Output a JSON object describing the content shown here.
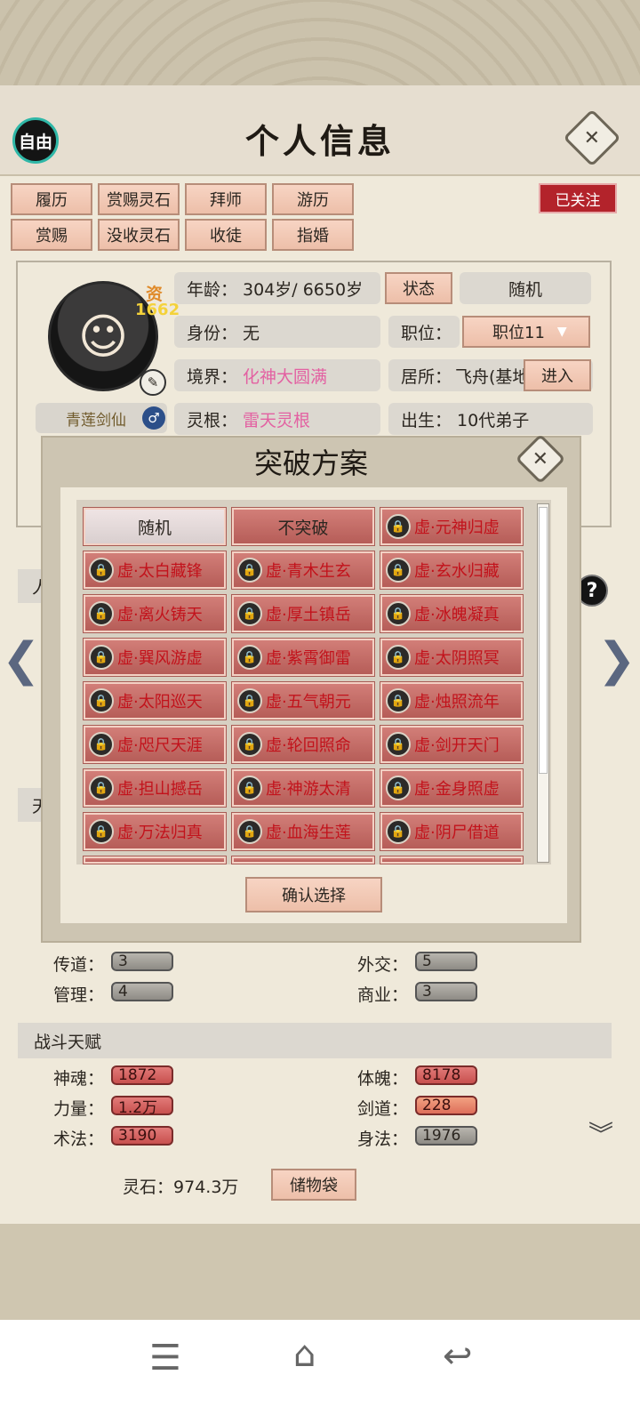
{
  "header": {
    "free_label": "自由",
    "title": "个人信息",
    "follow_label": "已关注"
  },
  "actions": {
    "row1": [
      "履历",
      "赏赐灵石",
      "拜师",
      "游历"
    ],
    "row2": [
      "赏赐",
      "没收灵石",
      "收徒",
      "指婚"
    ]
  },
  "character": {
    "avatar_glyph": "☺",
    "aptitude_label": "资",
    "aptitude_value": "1662",
    "name": "青莲剑仙",
    "gender_symbol": "♂"
  },
  "info": {
    "age_label": "年龄：",
    "age_value": "304岁/ 6650岁",
    "status_button": "状态",
    "random_button": "随机",
    "identity_label": "身份：",
    "identity_value": "无",
    "position_label": "职位：",
    "position_value": "职位11",
    "realm_label": "境界：",
    "realm_value": "化神大圆满",
    "residence_label": "居所：",
    "residence_value": "飞舟(基地",
    "enter_button": "进入",
    "root_label": "灵根：",
    "root_value": "雷天灵根",
    "birth_label": "出生：",
    "birth_value": "10代弟子"
  },
  "modal": {
    "title": "突破方案",
    "confirm_label": "确认选择",
    "options": [
      {
        "label": "随机",
        "style": "light",
        "locked": false
      },
      {
        "label": "不突破",
        "style": "plain",
        "locked": false
      },
      {
        "label": "虚·元神归虚",
        "style": "red",
        "locked": true
      },
      {
        "label": "虚·太白藏锋",
        "style": "red",
        "locked": true
      },
      {
        "label": "虚·青木生玄",
        "style": "red",
        "locked": true
      },
      {
        "label": "虚·玄水归藏",
        "style": "red",
        "locked": true
      },
      {
        "label": "虚·离火铸天",
        "style": "red",
        "locked": true
      },
      {
        "label": "虚·厚土镇岳",
        "style": "red",
        "locked": true
      },
      {
        "label": "虚·冰魄凝真",
        "style": "red",
        "locked": true
      },
      {
        "label": "虚·巽风游虚",
        "style": "red",
        "locked": true
      },
      {
        "label": "虚·紫霄御雷",
        "style": "red",
        "locked": true
      },
      {
        "label": "虚·太阴照冥",
        "style": "red",
        "locked": true
      },
      {
        "label": "虚·太阳巡天",
        "style": "red",
        "locked": true
      },
      {
        "label": "虚·五气朝元",
        "style": "red",
        "locked": true
      },
      {
        "label": "虚·烛照流年",
        "style": "red",
        "locked": true
      },
      {
        "label": "虚·咫尺天涯",
        "style": "red",
        "locked": true
      },
      {
        "label": "虚·轮回照命",
        "style": "red",
        "locked": true
      },
      {
        "label": "虚·剑开天门",
        "style": "red",
        "locked": true
      },
      {
        "label": "虚·担山撼岳",
        "style": "red",
        "locked": true
      },
      {
        "label": "虚·神游太清",
        "style": "red",
        "locked": true
      },
      {
        "label": "虚·金身照虚",
        "style": "red",
        "locked": true
      },
      {
        "label": "虚·万法归真",
        "style": "red",
        "locked": true
      },
      {
        "label": "虚·血海生莲",
        "style": "red",
        "locked": true
      },
      {
        "label": "虚·阴尸借道",
        "style": "red",
        "locked": true
      }
    ],
    "lock_glyph": "🔒"
  },
  "stats": {
    "mentor_label": "传道：",
    "mentor_value": "3",
    "diplomacy_label": "外交：",
    "diplomacy_value": "5",
    "manage_label": "管理：",
    "manage_value": "4",
    "commerce_label": "商业：",
    "commerce_value": "3"
  },
  "combat": {
    "section_title": "战斗天赋",
    "soul_label": "神魂：",
    "soul_value": "1872",
    "body_label": "体魄：",
    "body_value": "8178",
    "strength_label": "力量：",
    "strength_value": "1.2万",
    "sword_label": "剑道：",
    "sword_value": "228",
    "spell_label": "术法：",
    "spell_value": "3190",
    "agility_label": "身法：",
    "agility_value": "1976"
  },
  "footer": {
    "spirit_stone_label": "灵石：",
    "spirit_stone_value": "974.3万",
    "storage_button": "储物袋"
  },
  "partial_text": {
    "left_char_1": "人",
    "left_char_2": "天"
  }
}
